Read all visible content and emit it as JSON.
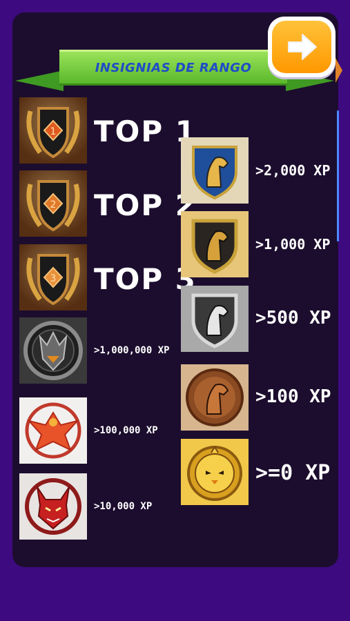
{
  "banner": {
    "title": "INSIGNIAS DE RANGO"
  },
  "next_button": {
    "icon": "arrow-right-icon"
  },
  "left_column": [
    {
      "badge": "gold-shield-laurel-badge",
      "number": "1",
      "label": "TOP 1"
    },
    {
      "badge": "gold-shield-laurel-badge",
      "number": "2",
      "label": "TOP 2"
    },
    {
      "badge": "gold-shield-laurel-badge",
      "number": "3",
      "label": "TOP 3"
    },
    {
      "badge": "steel-dragon-badge",
      "label": ">1,000,000 XP"
    },
    {
      "badge": "phoenix-badge",
      "label": ">100,000 XP"
    },
    {
      "badge": "red-demon-badge",
      "label": ">10,000 XP"
    }
  ],
  "right_column": [
    {
      "badge": "blue-horse-shield-badge",
      "label": ">2,000 XP"
    },
    {
      "badge": "gold-horse-shield-badge",
      "label": ">1,000 XP"
    },
    {
      "badge": "silver-horse-shield-badge",
      "label": ">500 XP"
    },
    {
      "badge": "bronze-horse-badge",
      "label": ">100 XP"
    },
    {
      "badge": "yellow-bird-badge",
      "label": ">=0 XP"
    }
  ],
  "colors": {
    "background": "#3d0a80",
    "panel": "#1c0d2e",
    "ribbon": "#5ab82a",
    "title_text": "#1e4cc8",
    "button": "#ff9800"
  }
}
